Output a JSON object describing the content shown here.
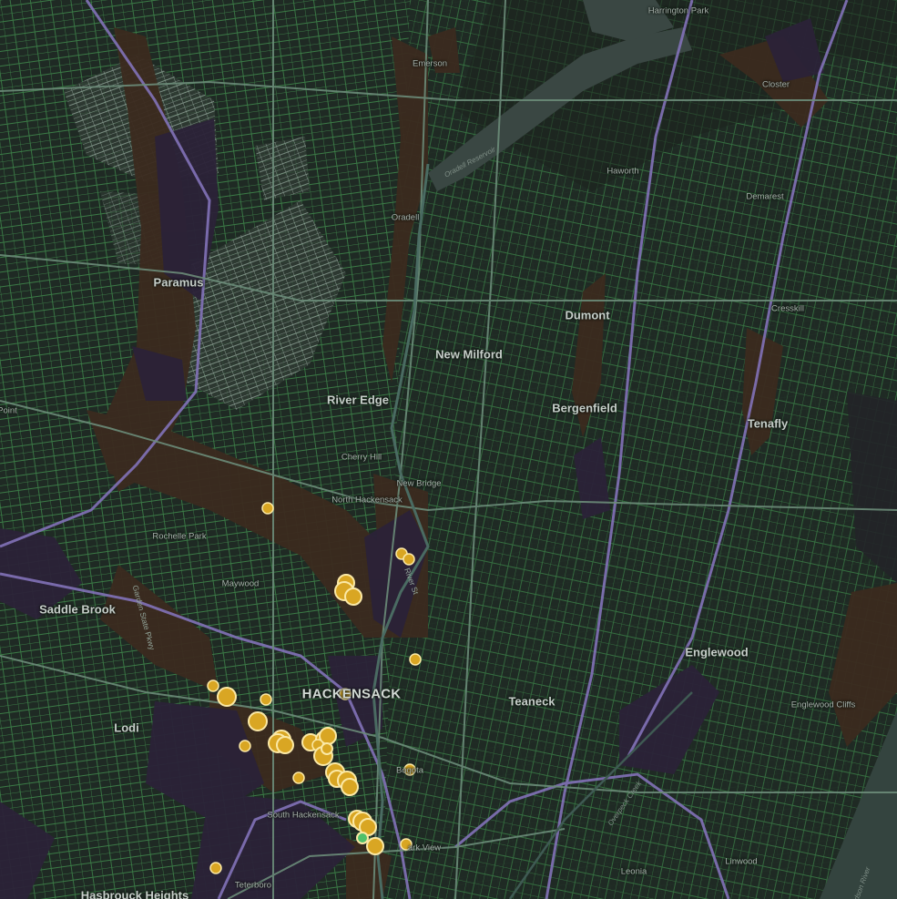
{
  "map": {
    "colors": {
      "background": "#1f2a24",
      "streets": "#3f8a4c",
      "major_roads": "#6b8c79",
      "highway": "#8272b8",
      "commercial": "#3b2a1f",
      "industrial": "#2b2238",
      "residential_light": "#8fa89a",
      "water": "#2a3a36",
      "marker_fill": "#d9a623",
      "marker_stroke": "#fbe9a6",
      "marker_green": "#4fc06a"
    },
    "places": [
      {
        "id": "harrington-park",
        "label": "Harrington Park",
        "tier": "small"
      },
      {
        "id": "emerson",
        "label": "Emerson",
        "tier": "small"
      },
      {
        "id": "closter",
        "label": "Closter",
        "tier": "small"
      },
      {
        "id": "haworth",
        "label": "Haworth",
        "tier": "small"
      },
      {
        "id": "demarest",
        "label": "Demarest",
        "tier": "small"
      },
      {
        "id": "oradell",
        "label": "Oradell",
        "tier": "small"
      },
      {
        "id": "paramus",
        "label": "Paramus",
        "tier": "town"
      },
      {
        "id": "dumont",
        "label": "Dumont",
        "tier": "town"
      },
      {
        "id": "cresskill",
        "label": "Cresskill",
        "tier": "small"
      },
      {
        "id": "new-milford",
        "label": "New Milford",
        "tier": "town"
      },
      {
        "id": "river-edge",
        "label": "River Edge",
        "tier": "town"
      },
      {
        "id": "bergenfield",
        "label": "Bergenfield",
        "tier": "town"
      },
      {
        "id": "tenafly",
        "label": "Tenafly",
        "tier": "town"
      },
      {
        "id": "point",
        "label": "Point",
        "tier": "small"
      },
      {
        "id": "cherry-hill",
        "label": "Cherry Hill",
        "tier": "small"
      },
      {
        "id": "new-bridge",
        "label": "New Bridge",
        "tier": "small"
      },
      {
        "id": "north-hackensack",
        "label": "North Hackensack",
        "tier": "small"
      },
      {
        "id": "rochelle-park",
        "label": "Rochelle Park",
        "tier": "small"
      },
      {
        "id": "maywood",
        "label": "Maywood",
        "tier": "small"
      },
      {
        "id": "saddle-brook",
        "label": "Saddle Brook",
        "tier": "town"
      },
      {
        "id": "englewood",
        "label": "Englewood",
        "tier": "town"
      },
      {
        "id": "hackensack",
        "label": "HACKENSACK",
        "tier": "city"
      },
      {
        "id": "teaneck",
        "label": "Teaneck",
        "tier": "town"
      },
      {
        "id": "lodi",
        "label": "Lodi",
        "tier": "town"
      },
      {
        "id": "englewood-cliffs",
        "label": "Englewood Cliffs",
        "tier": "small"
      },
      {
        "id": "bogota",
        "label": "Bogota",
        "tier": "small"
      },
      {
        "id": "south-hackensack",
        "label": "South Hackensack",
        "tier": "small"
      },
      {
        "id": "ridgefield-park-view",
        "label": "ark View",
        "tier": "small"
      },
      {
        "id": "linwood",
        "label": "Linwood",
        "tier": "small"
      },
      {
        "id": "leonia",
        "label": "Leonia",
        "tier": "small"
      },
      {
        "id": "teterboro",
        "label": "Teterboro",
        "tier": "small"
      },
      {
        "id": "hasbrouck-heights",
        "label": "Hasbrouck Heights",
        "tier": "town"
      }
    ],
    "road_labels": [
      {
        "id": "garden-state-parkway",
        "label": "Garden State Pkwy"
      },
      {
        "id": "river-street",
        "label": "River St"
      },
      {
        "id": "overpeck-creek",
        "label": "Overpeck Creek"
      },
      {
        "id": "hudson-river",
        "label": "Hudson River"
      },
      {
        "id": "oradell-reservoir",
        "label": "Oradell Reservoir"
      }
    ],
    "markers": [
      {
        "size": "small",
        "color": "gold"
      },
      {
        "size": "small",
        "color": "gold"
      },
      {
        "size": "small",
        "color": "gold"
      },
      {
        "size": "medium",
        "color": "gold"
      },
      {
        "size": "medium",
        "color": "gold"
      },
      {
        "size": "medium",
        "color": "gold"
      },
      {
        "size": "small",
        "color": "gold"
      },
      {
        "size": "small",
        "color": "gold"
      },
      {
        "size": "small",
        "color": "gold"
      },
      {
        "size": "medium",
        "color": "gold"
      },
      {
        "size": "small",
        "color": "gold"
      },
      {
        "size": "medium",
        "color": "gold"
      },
      {
        "size": "small",
        "color": "gold"
      },
      {
        "size": "medium",
        "color": "gold"
      },
      {
        "size": "medium",
        "color": "gold"
      },
      {
        "size": "medium",
        "color": "gold"
      },
      {
        "size": "medium",
        "color": "gold"
      },
      {
        "size": "medium",
        "color": "gold"
      },
      {
        "size": "medium",
        "color": "gold"
      },
      {
        "size": "small",
        "color": "gold"
      },
      {
        "size": "medium",
        "color": "gold"
      },
      {
        "size": "medium",
        "color": "gold"
      },
      {
        "size": "medium",
        "color": "gold"
      },
      {
        "size": "medium",
        "color": "gold"
      },
      {
        "size": "medium",
        "color": "gold"
      },
      {
        "size": "medium",
        "color": "gold"
      },
      {
        "size": "medium",
        "color": "gold"
      },
      {
        "size": "medium",
        "color": "gold"
      },
      {
        "size": "medium",
        "color": "gold"
      },
      {
        "size": "medium",
        "color": "green"
      },
      {
        "size": "small",
        "color": "gold"
      },
      {
        "size": "medium",
        "color": "gold"
      },
      {
        "size": "small",
        "color": "gold"
      },
      {
        "size": "small",
        "color": "gold"
      },
      {
        "size": "small",
        "color": "gold"
      }
    ]
  }
}
